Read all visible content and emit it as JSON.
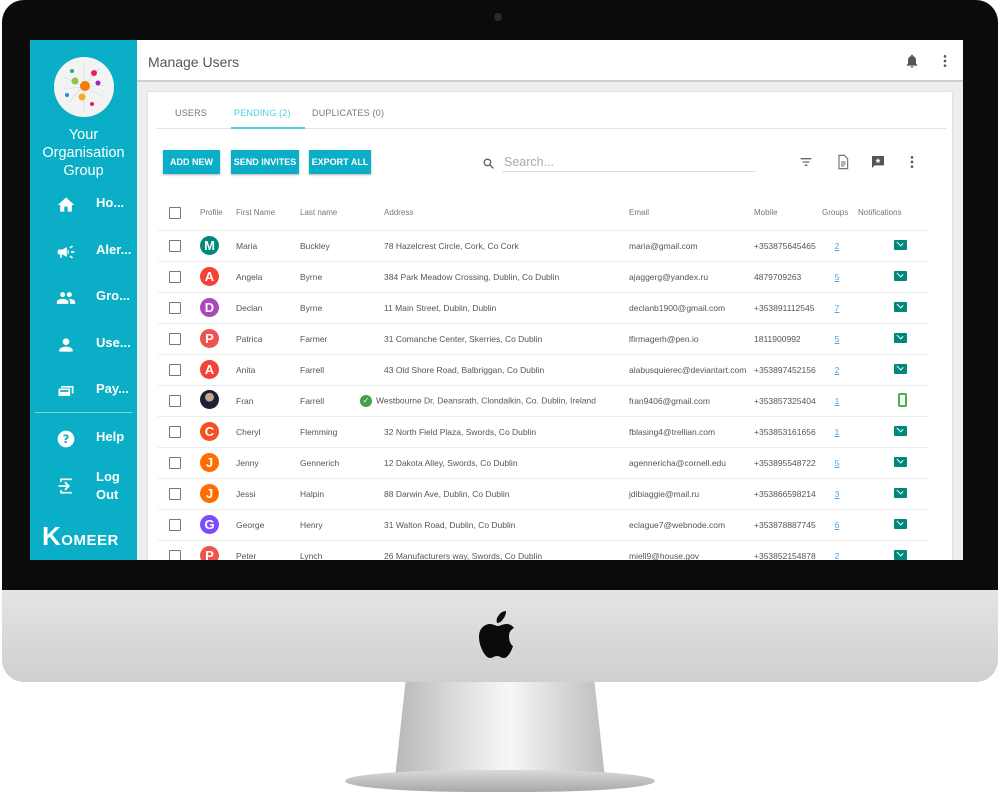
{
  "sidebar": {
    "org_name_lines": [
      "Your",
      "Organisation",
      "Group"
    ],
    "items": [
      {
        "label": "Ho...",
        "icon": "home-icon"
      },
      {
        "label": "Aler...",
        "icon": "megaphone-icon"
      },
      {
        "label": "Gro...",
        "icon": "groups-icon"
      },
      {
        "label": "Use...",
        "icon": "person-icon"
      },
      {
        "label": "Pay...",
        "icon": "payment-icon"
      },
      {
        "label": "Help",
        "icon": "help-icon"
      },
      {
        "label": "Log",
        "label2": "Out",
        "icon": "logout-icon"
      }
    ],
    "brand": "KOMEER"
  },
  "header": {
    "title": "Manage Users"
  },
  "tabs": [
    {
      "label": "USERS"
    },
    {
      "label": "PENDING (2)",
      "active": true
    },
    {
      "label": "DUPLICATES (0)"
    }
  ],
  "toolbar": {
    "add_new": "ADD NEW",
    "send_invites": "SEND INVITES",
    "export_all": "EXPORT ALL",
    "search_placeholder": "Search..."
  },
  "colors": {
    "brand": "#0aaec6",
    "accent": "#4dd0e1",
    "notification": "#00897b"
  },
  "table": {
    "columns": [
      "Profile",
      "First Name",
      "Last name",
      "Address",
      "Email",
      "Mobile",
      "Groups",
      "Notifications"
    ],
    "rows": [
      {
        "initial": "M",
        "color": "#00897b",
        "first": "Maria",
        "last": "Buckley",
        "address": "78 Hazelcrest Circle, Cork, Co Cork",
        "email": "maria@gmail.com",
        "mobile": "+353875645465",
        "groups": "2",
        "notify": "email"
      },
      {
        "initial": "A",
        "color": "#f44336",
        "first": "Angela",
        "last": "Byrne",
        "address": "384 Park Meadow Crossing, Dublin, Co Dublin",
        "email": "ajaggerg@yandex.ru",
        "mobile": "4879709263",
        "groups": "5",
        "notify": "email"
      },
      {
        "initial": "D",
        "color": "#ab47bc",
        "first": "Declan",
        "last": "Byrne",
        "address": "11 Main Street, Dublin, Dublin",
        "email": "declanb1900@gmail.com",
        "mobile": "+353891112545",
        "groups": "7",
        "notify": "email"
      },
      {
        "initial": "P",
        "color": "#ef5350",
        "first": "Patrica",
        "last": "Farmer",
        "address": "31 Comanche Center, Skerries, Co Dublin",
        "email": "lfirmagerh@pen.io",
        "mobile": "1811900992",
        "groups": "5",
        "notify": "email"
      },
      {
        "initial": "A",
        "color": "#f44336",
        "first": "Anita",
        "last": "Farrell",
        "address": "43 Old Shore Road, Balbriggan, Co Dublin",
        "email": "alabusquierec@deviantart.com",
        "mobile": "+353897452156",
        "groups": "2",
        "notify": "email"
      },
      {
        "initial": "",
        "photo": true,
        "verified": true,
        "first": "Fran",
        "last": "Farrell",
        "address": "Westbourne Dr, Deansrath, Clondalkin, Co. Dublin, Ireland",
        "email": "fran9406@gmail.com",
        "mobile": "+353857325404",
        "groups": "1",
        "notify": "phone"
      },
      {
        "initial": "C",
        "color": "#f4511e",
        "first": "Cheryl",
        "last": "Flemming",
        "address": "32 North Field Plaza, Swords, Co Dublin",
        "email": "fblasing4@trellian.com",
        "mobile": "+353853161656",
        "groups": "1",
        "notify": "email"
      },
      {
        "initial": "J",
        "color": "#ff6d00",
        "first": "Jenny",
        "last": "Gennerich",
        "address": "12 Dakota Alley, Swords, Co Dublin",
        "email": "agennericha@cornell.edu",
        "mobile": "+353895548722",
        "groups": "5",
        "notify": "email"
      },
      {
        "initial": "J",
        "color": "#ff6d00",
        "first": "Jessi",
        "last": "Halpin",
        "address": "88 Darwin Ave, Dublin, Co Dublin",
        "email": "jdibiaggie@mail.ru",
        "mobile": "+353866598214",
        "groups": "3",
        "notify": "email"
      },
      {
        "initial": "G",
        "color": "#7c4dff",
        "first": "George",
        "last": "Henry",
        "address": "31 Walton Road, Dublin, Co Dublin",
        "email": "eclague7@webnode.com",
        "mobile": "+353878887745",
        "groups": "6",
        "notify": "email"
      },
      {
        "initial": "P",
        "color": "#ef5350",
        "first": "Peter",
        "last": "Lynch",
        "address": "26 Manufacturers way, Swords, Co Dublin",
        "email": "miell9@house.gov",
        "mobile": "+353852154878",
        "groups": "2",
        "notify": "email"
      }
    ]
  }
}
